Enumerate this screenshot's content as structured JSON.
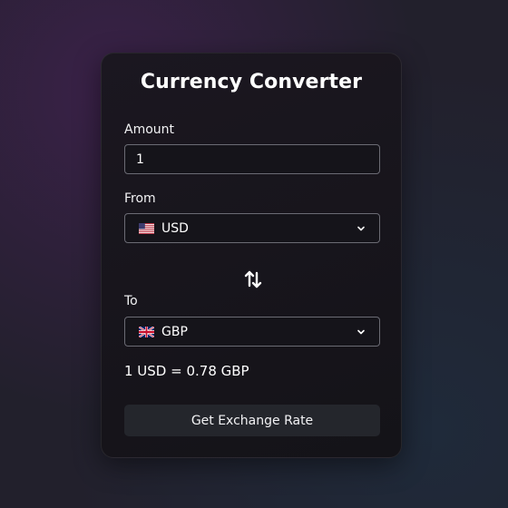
{
  "converter": {
    "title": "Currency Converter",
    "amount_label": "Amount",
    "amount_value": "1",
    "from_label": "From",
    "from_currency": "USD",
    "from_flag": "us-flag-icon",
    "to_label": "To",
    "to_currency": "GBP",
    "to_flag": "uk-flag-icon",
    "swap_icon": "swap-arrows-icon",
    "result_text": "1 USD = 0.78 GBP",
    "button_label": "Get Exchange Rate"
  },
  "colors": {
    "background": "#22202c",
    "card": "#16151a",
    "button": "#24262c",
    "border": "#6b6b74",
    "text": "#ffffff"
  }
}
